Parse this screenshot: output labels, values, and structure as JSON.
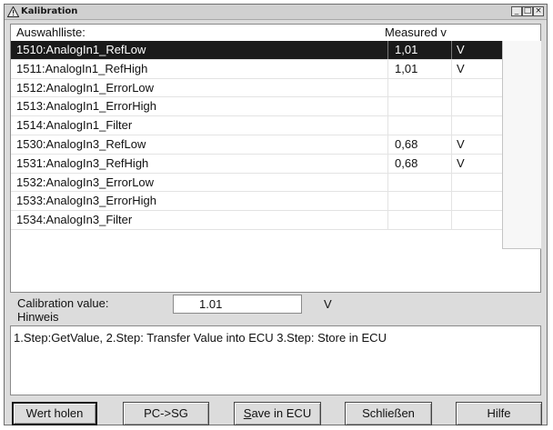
{
  "window": {
    "title": "Kalibration",
    "controls": {
      "minimize": "_",
      "maximize": "□",
      "close": "×"
    }
  },
  "list": {
    "header_name": "Auswahlliste:",
    "header_measured": "Measured v",
    "rows": [
      {
        "name": "1510:AnalogIn1_RefLow",
        "value": "1,01",
        "unit": "V",
        "selected": true
      },
      {
        "name": "1511:AnalogIn1_RefHigh",
        "value": "1,01",
        "unit": "V",
        "selected": false
      },
      {
        "name": "1512:AnalogIn1_ErrorLow",
        "value": "",
        "unit": "",
        "selected": false
      },
      {
        "name": "1513:AnalogIn1_ErrorHigh",
        "value": "",
        "unit": "",
        "selected": false
      },
      {
        "name": "1514:AnalogIn1_Filter",
        "value": "",
        "unit": "",
        "selected": false
      },
      {
        "name": "1530:AnalogIn3_RefLow",
        "value": "0,68",
        "unit": "V",
        "selected": false
      },
      {
        "name": "1531:AnalogIn3_RefHigh",
        "value": "0,68",
        "unit": "V",
        "selected": false
      },
      {
        "name": "1532:AnalogIn3_ErrorLow",
        "value": "",
        "unit": "",
        "selected": false
      },
      {
        "name": "1533:AnalogIn3_ErrorHigh",
        "value": "",
        "unit": "",
        "selected": false
      },
      {
        "name": "1534:AnalogIn3_Filter",
        "value": "",
        "unit": "",
        "selected": false
      }
    ]
  },
  "calibration": {
    "label": "Calibration value:",
    "value": "1.01",
    "unit": "V"
  },
  "hint": {
    "label": "Hinweis",
    "text": "1.Step:GetValue, 2.Step: Transfer Value into ECU 3.Step: Store in ECU"
  },
  "buttons": {
    "get_value": "Wert holen",
    "pc_to_sg": "PC->SG",
    "save_first": "S",
    "save_rest": "ave in ECU",
    "close": "Schließen",
    "help": "Hilfe"
  },
  "icons": {
    "title_icon": "warning-triangle-icon"
  }
}
